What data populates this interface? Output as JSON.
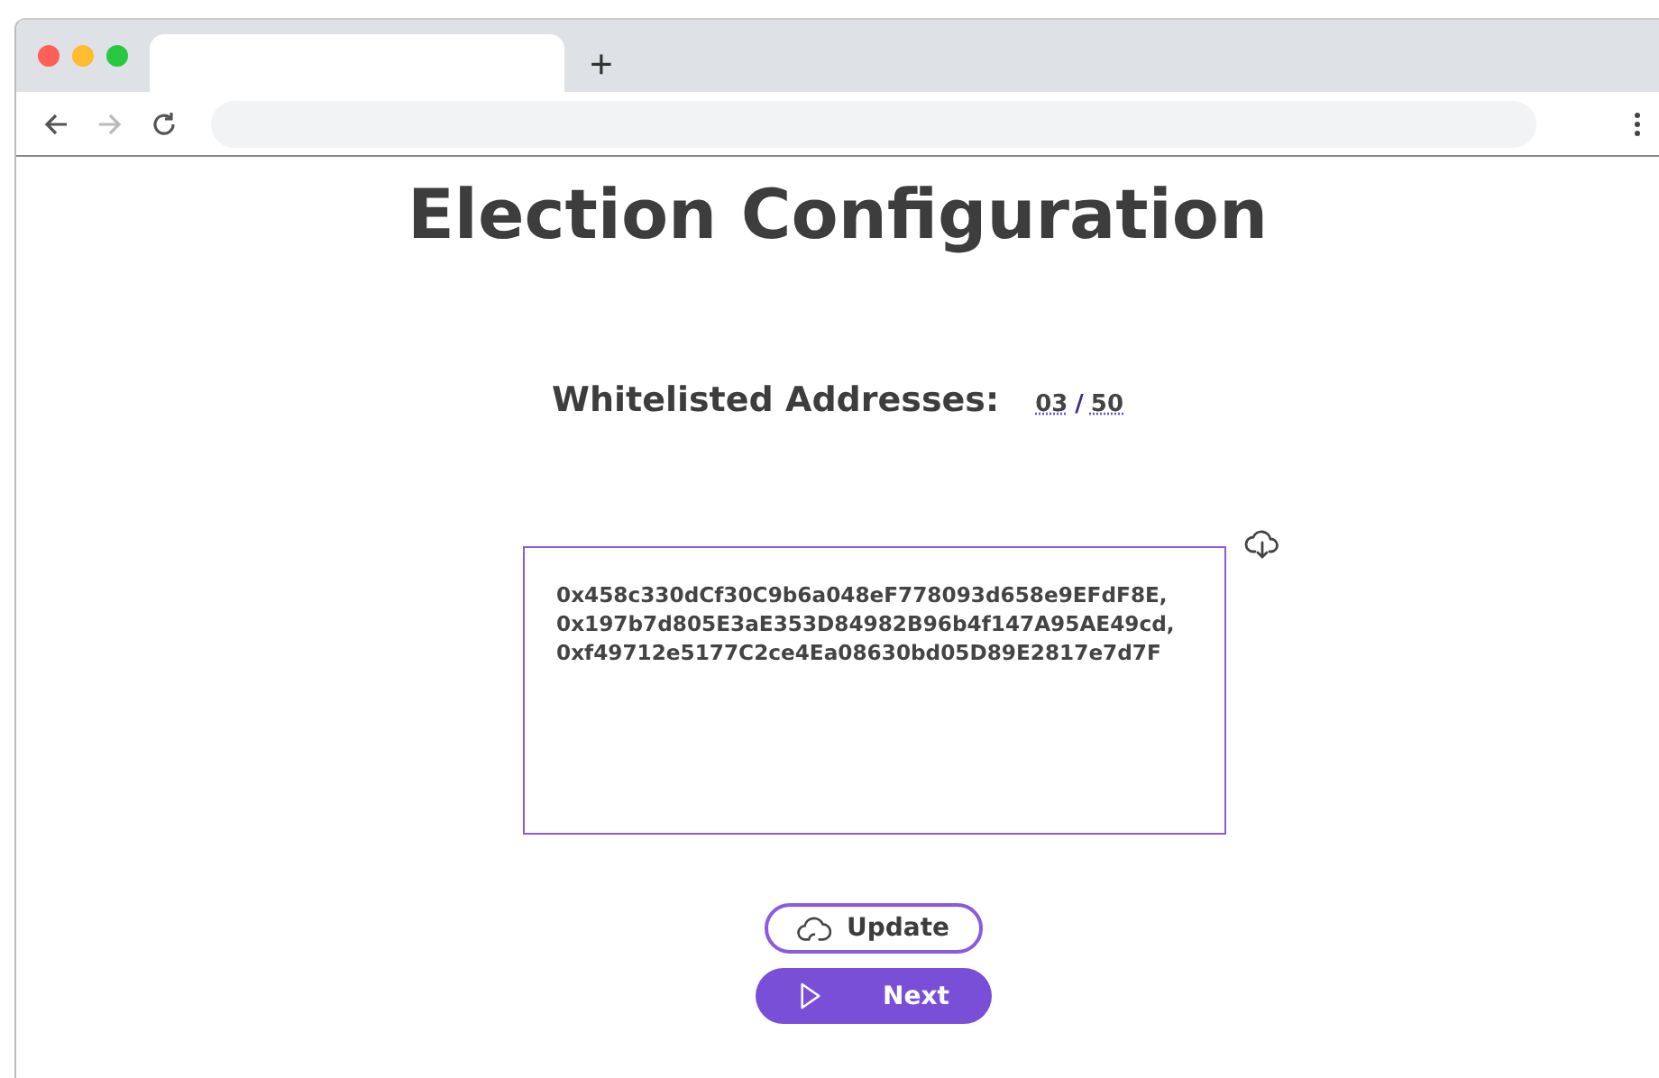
{
  "browser": {
    "new_tab": "+"
  },
  "heading": "Election Configuration",
  "whitelist": {
    "label": "Whitelisted Addresses:",
    "count": "03",
    "separator": "/",
    "max": "50"
  },
  "addresses": "0x458c330dCf30C9b6a048eF778093d658e9EFdF8E,\n0x197b7d805E3aE353D84982B96b4f147A95AE49cd,\n0xf49712e5177C2ce4Ea08630bd05D89E2817e7d7F",
  "buttons": [
    {
      "kind": "outline",
      "label": "Update"
    },
    {
      "kind": "filled",
      "label": "Next"
    }
  ]
}
